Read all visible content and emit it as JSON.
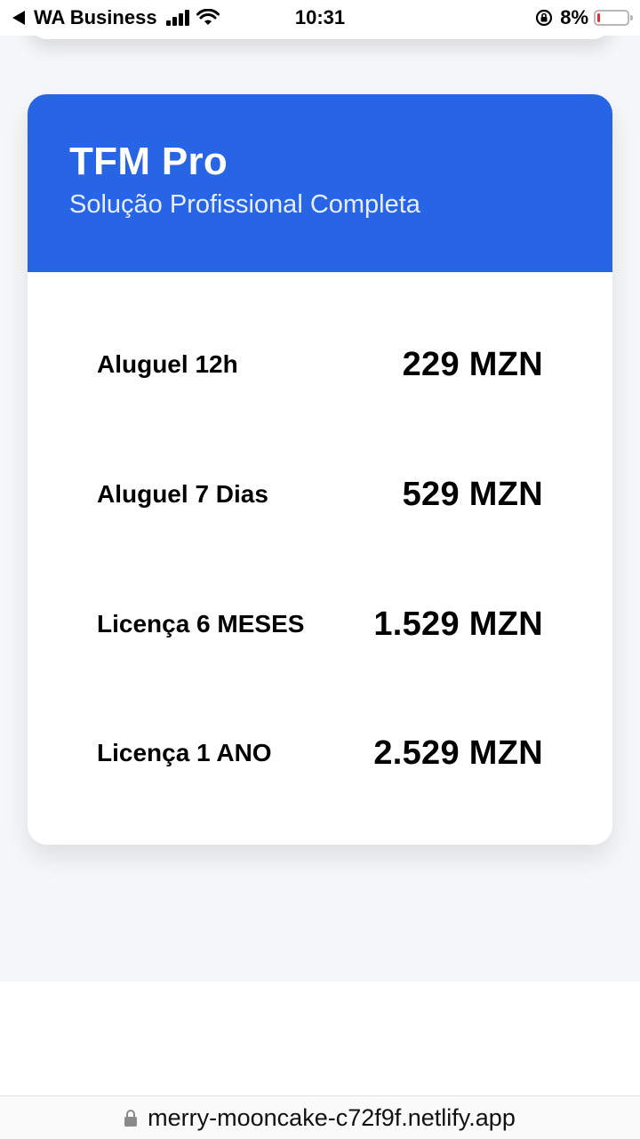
{
  "status_bar": {
    "back_app": "WA Business",
    "time": "10:31",
    "battery_percent": "8%",
    "battery_level": 0.08,
    "battery_color": "#e02e2e"
  },
  "card": {
    "title": "TFM Pro",
    "subtitle": "Solução Profissional Completa",
    "header_color": "#2764e6",
    "plans": [
      {
        "name": "Aluguel 12h",
        "price": "229 MZN"
      },
      {
        "name": "Aluguel 7 Dias",
        "price": "529 MZN"
      },
      {
        "name": "Licença 6 MESES",
        "price": "1.529 MZN"
      },
      {
        "name": "Licença 1 ANO",
        "price": "2.529 MZN"
      }
    ]
  },
  "browser": {
    "url": "merry-mooncake-c72f9f.netlify.app",
    "lock_icon": "lock-icon"
  }
}
